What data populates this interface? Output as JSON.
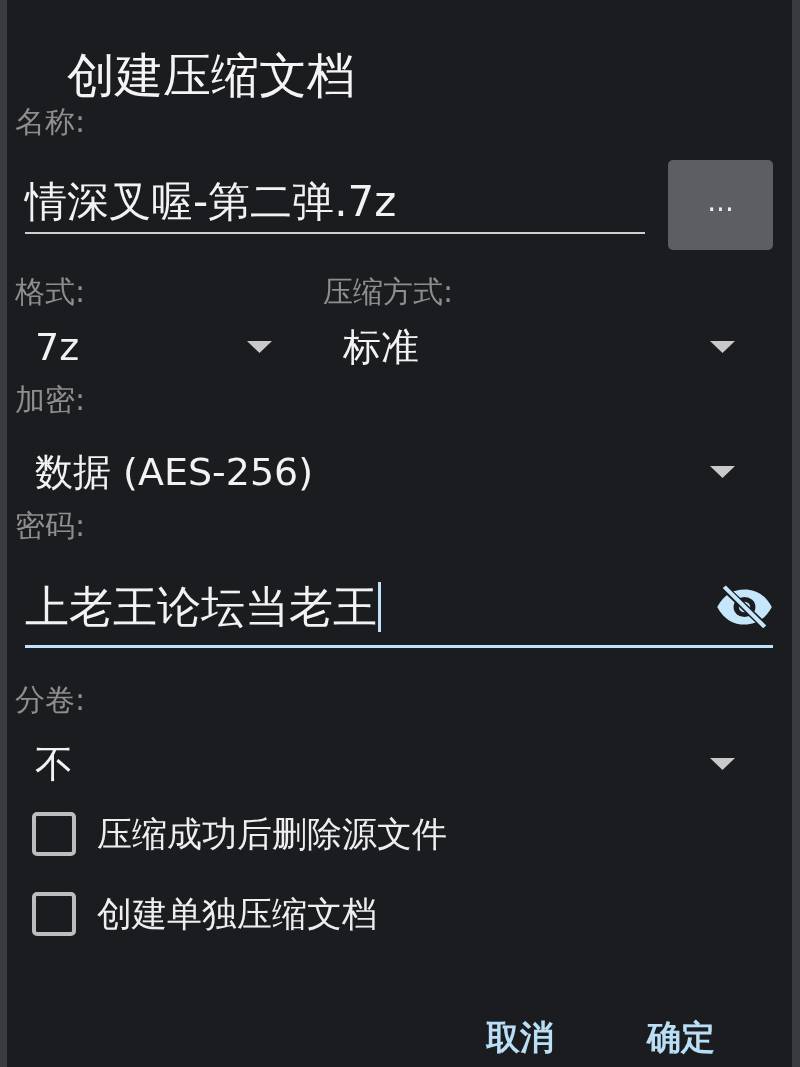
{
  "dialog": {
    "title": "创建压缩文档"
  },
  "name": {
    "label": "名称:",
    "value": "情深叉喔-第二弹.7z",
    "focused": false,
    "browse_button": "..."
  },
  "format": {
    "label": "格式:",
    "value": "7z"
  },
  "compression": {
    "label": "压缩方式:",
    "value": "标准"
  },
  "encryption": {
    "label": "加密:",
    "value": "数据 (AES-256)"
  },
  "password": {
    "label": "密码:",
    "value": "上老王论坛当老王",
    "focused": true
  },
  "split": {
    "label": "分卷:",
    "value": "不"
  },
  "options": [
    {
      "label": "压缩成功后删除源文件",
      "checked": false
    },
    {
      "label": "创建单独压缩文档",
      "checked": false
    }
  ],
  "buttons": [
    {
      "label": "取消"
    },
    {
      "label": "确定"
    }
  ]
}
